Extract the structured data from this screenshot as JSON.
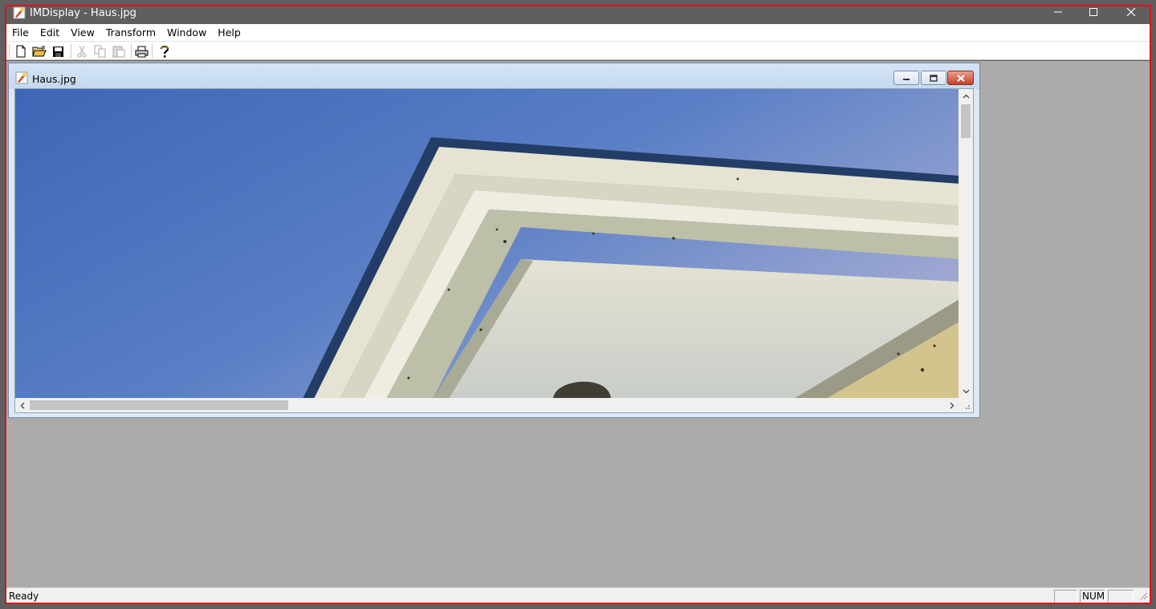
{
  "window": {
    "title": "IMDisplay - Haus.jpg",
    "app_icon": "imdisplay-icon",
    "controls": [
      "minimize-icon",
      "maximize-icon",
      "close-icon"
    ]
  },
  "menubar": {
    "items": [
      "File",
      "Edit",
      "View",
      "Transform",
      "Window",
      "Help"
    ]
  },
  "toolbar": {
    "buttons": [
      "new-icon",
      "open-icon",
      "save-icon",
      "cut-icon",
      "copy-icon",
      "paste-icon",
      "print-icon",
      "help-icon"
    ]
  },
  "child_window": {
    "title": "Haus.jpg",
    "icon": "imdisplay-icon",
    "controls": [
      "minimize-icon",
      "restore-icon",
      "close-icon"
    ],
    "image_description_icon": "house-roof-photo"
  },
  "statusbar": {
    "text": "Ready",
    "panels": [
      "",
      "NUM",
      ""
    ]
  },
  "colors": {
    "frame_border": "#e0101a",
    "titlebar": "#5f5f5f",
    "mdi_background": "#ababab",
    "sky": "#4670c0"
  }
}
